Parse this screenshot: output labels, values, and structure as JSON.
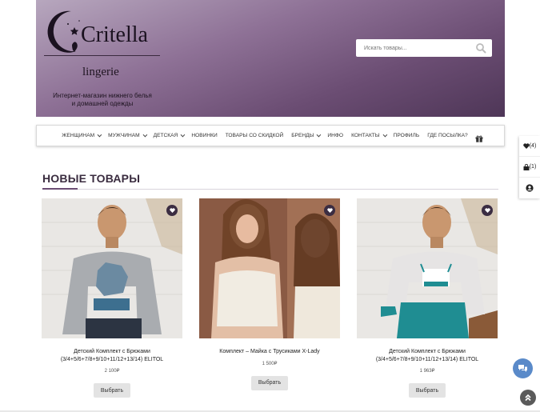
{
  "header": {
    "logo_text": "Critella",
    "logo_sub": "lingerie",
    "tagline": "Интернет-магазин нижнего белья и домашней одежды",
    "search_placeholder": "Искать товары..."
  },
  "nav": {
    "items": [
      {
        "label": "Женщинам",
        "dropdown": true
      },
      {
        "label": "Мужчинам",
        "dropdown": true
      },
      {
        "label": "Детская",
        "dropdown": true
      },
      {
        "label": "Новинки",
        "dropdown": false
      },
      {
        "label": "Товары со скидкой",
        "dropdown": false
      },
      {
        "label": "Бренды",
        "dropdown": true
      },
      {
        "label": "Инфо",
        "dropdown": false
      },
      {
        "label": "Контакты",
        "dropdown": true
      },
      {
        "label": "Профиль",
        "dropdown": false
      },
      {
        "label": "Где посылка?",
        "dropdown": false
      }
    ]
  },
  "side": {
    "wishlist_count": "(4)",
    "cart_count": "(1)"
  },
  "section": {
    "title": "НОВЫЕ ТОВАРЫ"
  },
  "products": [
    {
      "name": "Детский Комплект с Брюками (3/4+5/6+7/8+9/10+11/12+13/14) ELITOL",
      "price": "2 100₽",
      "button": "Выбрать"
    },
    {
      "name": "Комплект – Майка с Трусиками X-Lady",
      "price": "1 500₽",
      "button": "Выбрать"
    },
    {
      "name": "Детский Комплект с Брюками (3/4+5/6+7/8+9/10+11/12+13/14) ELITOL",
      "price": "1 963₽",
      "button": "Выбрать"
    }
  ],
  "colors": {
    "brand": "#6b4d73",
    "dark": "#3b2d42",
    "chat": "#5a8ac9"
  }
}
